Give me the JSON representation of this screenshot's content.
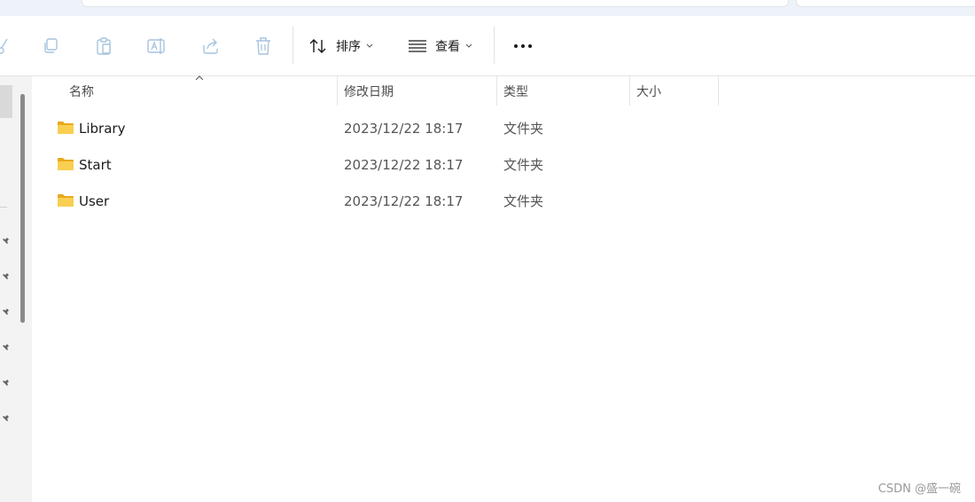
{
  "toolbar": {
    "sort_label": "排序",
    "view_label": "查看",
    "buttons": [
      {
        "icon": "cut-icon"
      },
      {
        "icon": "copy-icon"
      },
      {
        "icon": "paste-icon"
      },
      {
        "icon": "rename-icon"
      },
      {
        "icon": "share-icon"
      },
      {
        "icon": "delete-icon"
      },
      {
        "icon": "sort-icon"
      },
      {
        "icon": "view-icon"
      },
      {
        "icon": "more-icon"
      }
    ]
  },
  "columns": {
    "name": "名称",
    "date": "修改日期",
    "type": "类型",
    "size": "大小"
  },
  "files": [
    {
      "name": "Library",
      "modified": "2023/12/22 18:17",
      "type": "文件夹",
      "size": "",
      "icon": "folder-icon"
    },
    {
      "name": "Start",
      "modified": "2023/12/22 18:17",
      "type": "文件夹",
      "size": "",
      "icon": "folder-icon"
    },
    {
      "name": "User",
      "modified": "2023/12/22 18:17",
      "type": "文件夹",
      "size": "",
      "icon": "folder-icon"
    }
  ],
  "watermark": "CSDN @盛一碗",
  "colors": {
    "accent": "#0067c0",
    "folder": "#f5c544",
    "disabled_icon": "#a6c4de"
  }
}
